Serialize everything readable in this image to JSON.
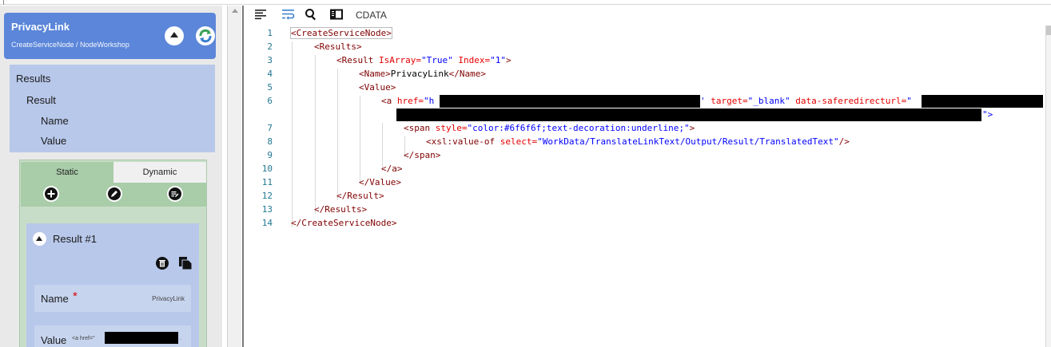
{
  "node": {
    "title": "PrivacyLink",
    "path": "CreateServiceNode / NodeWorkshop"
  },
  "tree": {
    "items": [
      {
        "label": "Results"
      },
      {
        "label": "Result"
      },
      {
        "label": "Name"
      },
      {
        "label": "Value"
      }
    ]
  },
  "tabs": {
    "static": "Static",
    "dynamic": "Dynamic"
  },
  "result_card": {
    "title": "Result #1",
    "name_label": "Name",
    "name_required": "*",
    "name_value": "PrivacyLink",
    "value_label": "Value",
    "value_preview": "<a href=\"",
    "value_tail": "."
  },
  "toolbar": {
    "cdata_label": "CDATA"
  },
  "code": {
    "line_numbers": [
      "1",
      "2",
      "3",
      "4",
      "5",
      "6",
      "7",
      "8",
      "9",
      "10",
      "11",
      "12",
      "13",
      "14"
    ],
    "l1_tag": "<CreateServiceNode>",
    "l2_tag": "<Results>",
    "l3_tag": "<Result",
    "l3_attr1": "IsArray=",
    "l3_val1": "\"True\"",
    "l3_attr2": "Index=",
    "l3_val2": "\"1\"",
    "l3_close": ">",
    "l4_open": "<Name>",
    "l4_text": "PrivacyLink",
    "l4_close": "</Name>",
    "l5_tag": "<Value>",
    "l6_tag": "<a",
    "l6_attr1": "href=",
    "l6_val1_start": "\"h",
    "l6_val1_end": "'",
    "l6_attr2": "target=",
    "l6_val2": "\"_blank\"",
    "l6_attr3": "data-saferedirecturl=",
    "l6_val3_start": "\"",
    "l6_cont_end": "\">",
    "l7_tag": "<span",
    "l7_attr": "style=",
    "l7_val": "\"color:#6f6f6f;text-decoration:underline;\"",
    "l7_close": ">",
    "l8_tag": "<xsl:value-of",
    "l8_attr": "select=",
    "l8_val": "\"WorkData/TranslateLinkText/Output/Result/TranslatedText\"",
    "l8_close": "/>",
    "l9_tag": "</span>",
    "l10_tag": "</a>",
    "l11_tag": "</Value>",
    "l12_tag": "</Result>",
    "l13_tag": "</Results>",
    "l14_tag": "</CreateServiceNode>"
  },
  "colors": {
    "node_header": "#5b86d9",
    "tree_bg": "#b8c8ea",
    "static_tab": "#a9cca9",
    "tag": "#800000",
    "attr": "#e50000",
    "value": "#0000ff",
    "line_number": "#237893"
  }
}
